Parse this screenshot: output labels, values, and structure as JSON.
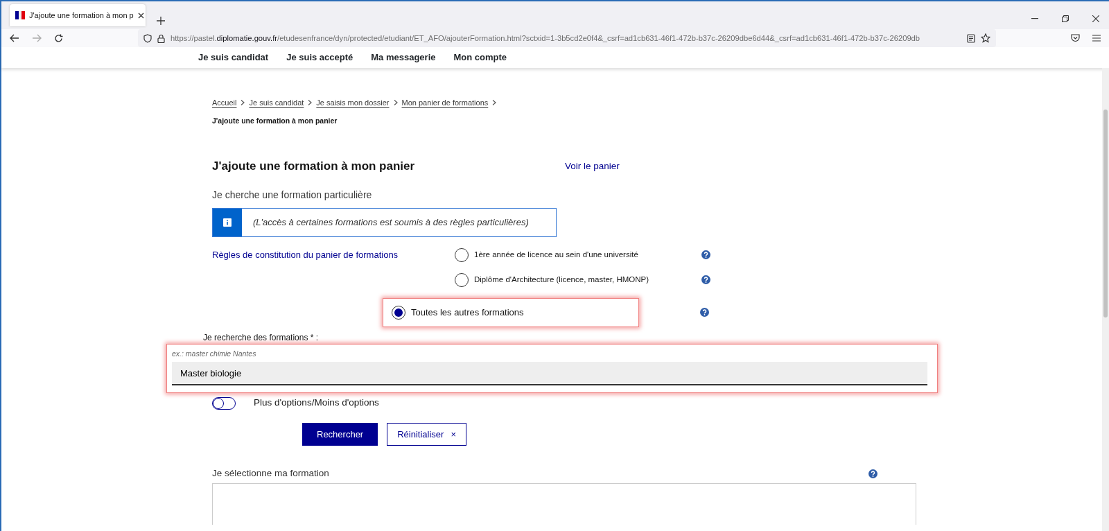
{
  "browser": {
    "tab": {
      "title": "J'ajoute une formation à mon p",
      "selected": true
    },
    "address": {
      "prefix": "https://pastel.",
      "domain": "diplomatie.gouv.fr",
      "rest": "/etudesenfrance/dyn/protected/etudiant/ET_AFO/ajouterFormation.html?sctxid=1-3b5cd2e0f4&_csrf=ad1cb631-46f1-472b-b37c-26209dbe6d44&_csrf=ad1cb631-46f1-472b-b37c-26209db"
    }
  },
  "nav": [
    "Je suis candidat",
    "Je suis accepté",
    "Ma messagerie",
    "Mon compte"
  ],
  "breadcrumb": {
    "links": [
      "Accueil",
      "Je suis candidat",
      "Je saisis mon dossier",
      "Mon panier de formations"
    ],
    "current": "J'ajoute une formation à mon panier"
  },
  "title": "J'ajoute une formation à mon panier",
  "cart_link": "Voir le panier",
  "subtitle": "Je cherche une formation particulière",
  "info": "(L'accès à certaines formations est soumis à des règles particulières)",
  "rules_link": "Règles de constitution du panier de formations",
  "options": [
    {
      "label": "1ère année de licence au sein d'une université",
      "selected": false,
      "highlighted": false
    },
    {
      "label": "Diplôme d'Architecture (licence, master, HMONP)",
      "selected": false,
      "highlighted": false
    },
    {
      "label": "Toutes les autres formations",
      "selected": true,
      "highlighted": true
    }
  ],
  "search": {
    "label": "Je recherche des formations * :",
    "hint": "ex.: master chimie Nantes",
    "value": "Master biologie",
    "highlighted": true
  },
  "more_options": {
    "label": "Plus d'options/Moins d'options",
    "on": false
  },
  "buttons": [
    {
      "label": "Rechercher",
      "kind": "primary"
    },
    {
      "label": "Réinitialiser",
      "kind": "secondary",
      "icon": "×"
    }
  ],
  "select_heading": "Je sélectionne ma formation"
}
